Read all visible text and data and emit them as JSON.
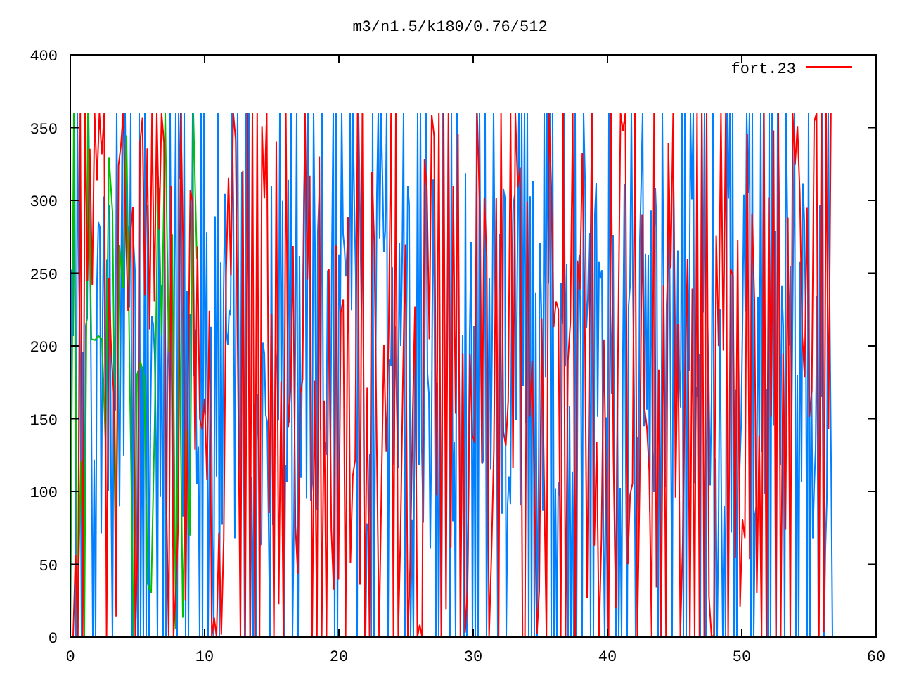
{
  "title": "m3/n1.5/k180/0.76/512",
  "legend": [
    {
      "label": "fort.23",
      "color": "#ff0000"
    }
  ],
  "y_axis": {
    "ticks": [
      "400",
      "350",
      "300",
      "250",
      "200",
      "150",
      "100",
      "50",
      "0"
    ]
  },
  "x_axis": {
    "ticks": [
      "0",
      "10",
      "20",
      "30",
      "40",
      "50",
      "60"
    ]
  }
}
